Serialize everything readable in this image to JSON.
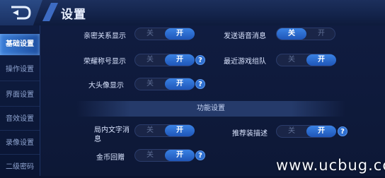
{
  "header": {
    "title": "设置"
  },
  "sidebar": {
    "items": [
      {
        "label": "基础设置"
      },
      {
        "label": "操作设置"
      },
      {
        "label": "界面设置"
      },
      {
        "label": "音效设置"
      },
      {
        "label": "录像设置"
      },
      {
        "label": "二级密码"
      }
    ],
    "active_index": 0
  },
  "toggle_text": {
    "off": "关",
    "on": "开"
  },
  "help_glyph": "?",
  "settings": {
    "intimacy": {
      "label": "亲密关系显示",
      "value": "开"
    },
    "voice_msg": {
      "label": "发送语音消息",
      "value": "关"
    },
    "honor_title": {
      "label": "荣耀称号显示",
      "value": "开"
    },
    "recent_team": {
      "label": "最近游戏组队",
      "value": "开"
    },
    "big_avatar": {
      "label": "大头像显示",
      "value": "开"
    }
  },
  "function_section": {
    "title": "功能设置",
    "items": {
      "ingame_text": {
        "label_line1": "局内文字消",
        "label_line2": "息",
        "value": "开"
      },
      "recommend_gear": {
        "label": "推荐装描述",
        "value": "开"
      },
      "gold_gift": {
        "label": "金币回赠",
        "value": "开"
      }
    }
  },
  "watermark": "www.ucbug.cc",
  "colors": {
    "accent": "#2f72d6",
    "background": "#0b1430"
  }
}
